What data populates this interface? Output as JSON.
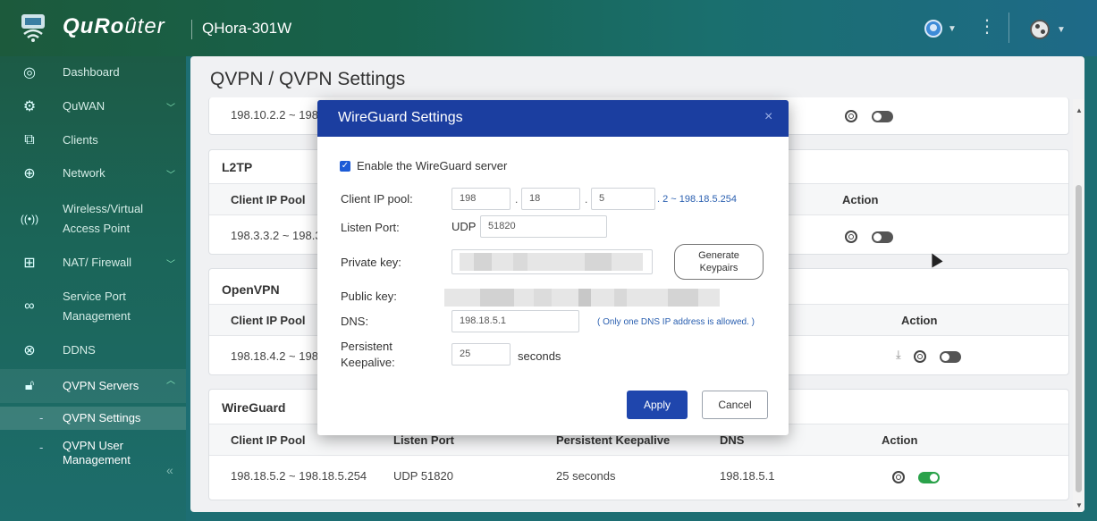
{
  "header": {
    "brand_bold": "QuRo",
    "brand_rest": "ûter",
    "device_name": "QHora-301W"
  },
  "sidebar": {
    "items": [
      {
        "label": "Dashboard",
        "icon": "dashboard-icon"
      },
      {
        "label": "QuWAN",
        "icon": "quwan-icon"
      },
      {
        "label": "Clients",
        "icon": "clients-icon"
      },
      {
        "label": "Network",
        "icon": "network-globe-icon"
      },
      {
        "label": "Wireless/Virtual",
        "label2": "Access Point",
        "icon": "wifi-icon"
      },
      {
        "label": "NAT/ Firewall",
        "icon": "firewall-icon"
      },
      {
        "label": "Service Port",
        "label2": "Management",
        "icon": "service-port-icon"
      },
      {
        "label": "DDNS",
        "icon": "ddns-icon"
      },
      {
        "label": "QVPN Servers",
        "icon": "lock-icon"
      }
    ],
    "sub_items": [
      {
        "label": "QVPN Settings"
      },
      {
        "label": "QVPN User",
        "label2": "Management"
      }
    ],
    "collapse_glyph": "«"
  },
  "main": {
    "title": "QVPN / QVPN Settings",
    "top_row": {
      "pool": "198.10.2.2 ~ 198."
    },
    "l2tp": {
      "title": "L2TP",
      "col_pool": "Client IP Pool",
      "col_action": "Action",
      "row_pool": "198.3.3.2 ~ 198.3."
    },
    "openvpn": {
      "title": "OpenVPN",
      "col_pool": "Client IP Pool",
      "col_action": "Action",
      "row_pool": "198.18.4.2 ~ 198."
    },
    "wireguard": {
      "title": "WireGuard",
      "cols": [
        "Client IP Pool",
        "Listen Port",
        "Persistent Keepalive",
        "DNS",
        "Action"
      ],
      "row": [
        "198.18.5.2 ~ 198.18.5.254",
        "UDP 51820",
        "25 seconds",
        "198.18.5.1"
      ]
    }
  },
  "modal": {
    "title": "WireGuard Settings",
    "close": "×",
    "enable_label": "Enable the WireGuard server",
    "enable_checked": true,
    "client_ip_pool_label": "Client IP pool:",
    "ip_octets": [
      "198",
      "18",
      "5"
    ],
    "ip_range_hint": ". 2 ~ 198.18.5.254",
    "listen_port_label": "Listen Port:",
    "listen_port_proto": "UDP",
    "listen_port_value": "51820",
    "private_key_label": "Private key:",
    "generate_label_1": "Generate",
    "generate_label_2": "Keypairs",
    "public_key_label": "Public key:",
    "dns_label": "DNS:",
    "dns_value": "198.18.5.1",
    "dns_hint": "( Only one DNS IP address is allowed. )",
    "keepalive_label_1": "Persistent",
    "keepalive_label_2": "Keepalive:",
    "keepalive_value": "25",
    "keepalive_unit": "seconds",
    "apply_label": "Apply",
    "cancel_label": "Cancel"
  },
  "colors": {
    "modal_header": "#1b3ea0",
    "apply_button": "#1f46ad",
    "toggle_on": "#2aa24a",
    "checkbox": "#1c5bd6"
  }
}
